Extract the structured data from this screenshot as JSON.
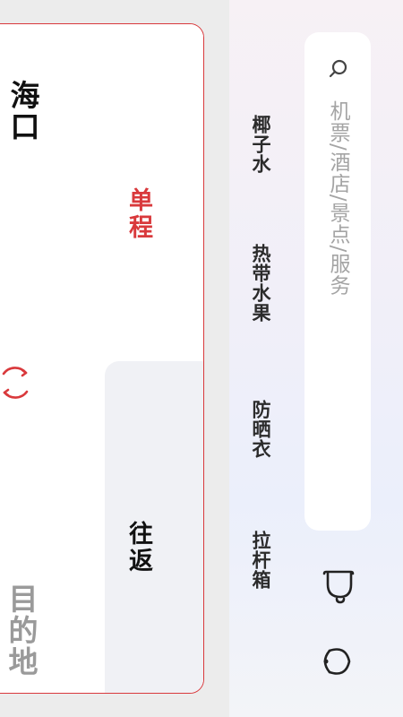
{
  "search": {
    "placeholder": "机票/酒店/景点/服务"
  },
  "hot_searches": [
    "椰子水",
    "热带水果",
    "防晒衣",
    "拉杆箱"
  ],
  "trip": {
    "origin": "海口",
    "destination": "目的地",
    "tabs": [
      {
        "label": "单程",
        "active": true
      },
      {
        "label": "往返",
        "active": false
      }
    ]
  },
  "colors": {
    "accent": "#d9393c",
    "placeholder": "#a4a4a4",
    "text_dark": "#111111",
    "text_muted": "#9a9a9a"
  },
  "icons": [
    "search-icon",
    "bell-icon",
    "headset-icon",
    "swap-icon"
  ]
}
